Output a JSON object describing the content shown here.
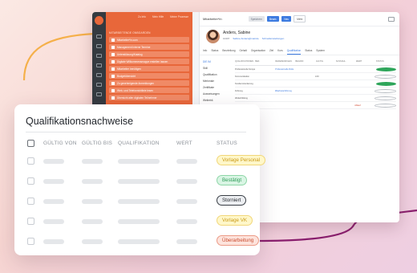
{
  "colors": {
    "accent_orange": "#e8673a",
    "accent_blue": "#3d7be0",
    "swoosh_orange": "#f5b04a",
    "swoosh_purple": "#8a1f6e",
    "status_yellow": "#f1d77a",
    "status_green": "#2f9b58",
    "status_red": "#c94b2e"
  },
  "background_app": {
    "orange_panel": {
      "top_links": [
        "Zu Info",
        "Mein Hilfe",
        "Meine Prozesse"
      ],
      "heading": "MITARBEITENDE ONBOARDEN",
      "items": [
        "Mitarbeiter*in.com",
        "Management interne Termine",
        "Unterstützung/Katalog",
        "Digitale Willkommensmappe erstellen lassen",
        "Mitarbeiter benötigen",
        "Budgetübersicht",
        "Zu genehmigende Anmeldungen",
        "Web- und Telefonrichtlinie lesen",
        "Übersicht aller digitalen Teilnehmer"
      ]
    },
    "topbar": {
      "title": "Mitarbeiter*in",
      "buttons": [
        "Speichern",
        "Bearb.",
        "Neu",
        "Mehr"
      ]
    },
    "profile": {
      "name": "Anders, Sabine",
      "id": "10407",
      "link_1": "Sabine.Anders@mail.de",
      "link_2": "Schnelleinstellungen"
    },
    "tabs": [
      "Info",
      "Status",
      "Beurteilung",
      "Gehalt",
      "Organisation",
      "Ziel",
      "Kurs",
      "Qualifikation",
      "Status",
      "System"
    ],
    "active_tab_index": 7,
    "left_nav": [
      "DIE IM",
      "Skill",
      "Qualifikation",
      "Merkmale",
      "Zertifikate",
      "Ausweisungen",
      "Weiterbil."
    ],
    "active_left_nav_index": 0,
    "mini_table": {
      "headers": [
        "QUALIFIKATIONEN",
        "BEZ.",
        "REFERENZ/GEN.",
        "BEGINN",
        "GÜLTIG",
        "AUSSCHL.",
        "WERT",
        "STATUS"
      ],
      "rows": [
        {
          "cells": [
            "Professionelle Kompetenzen",
            "",
            "Professionelle Rolle",
            "",
            "",
            "",
            "",
            ""
          ],
          "status": "green"
        },
        {
          "cells": [
            "Kommunikation",
            "",
            "",
            "",
            "1.00",
            "",
            "",
            ""
          ],
          "status": "empty"
        },
        {
          "cells": [
            "Kundenorientierung",
            "",
            "",
            "",
            "",
            "",
            "",
            ""
          ],
          "status": "green"
        },
        {
          "cells": [
            "Führung",
            "",
            "Mitarbeiterführung",
            "",
            "",
            "",
            "",
            ""
          ],
          "status": "empty"
        },
        {
          "cells": [
            "Weiterbildung",
            "",
            "",
            "",
            "",
            "",
            "",
            ""
          ],
          "status": "empty"
        },
        {
          "cells": [
            "Service",
            "",
            "",
            "",
            "",
            "",
            "Ablauf",
            ""
          ],
          "status": "red"
        }
      ]
    }
  },
  "card": {
    "title": "Qualifikationsnachweise",
    "headers": {
      "valid_from": "GÜLTIG VON",
      "valid_to": "GÜLTIG BIS",
      "qualification": "QUALIFIKATION",
      "value": "WERT",
      "status": "STATUS"
    },
    "rows": [
      {
        "status": "Vorlage Personal",
        "tone": "yellow"
      },
      {
        "status": "Bestätigt",
        "tone": "green"
      },
      {
        "status": "Storniert",
        "tone": "gray"
      },
      {
        "status": "Vorlage VK",
        "tone": "yellow"
      },
      {
        "status": "Überarbeitung",
        "tone": "red"
      }
    ]
  }
}
